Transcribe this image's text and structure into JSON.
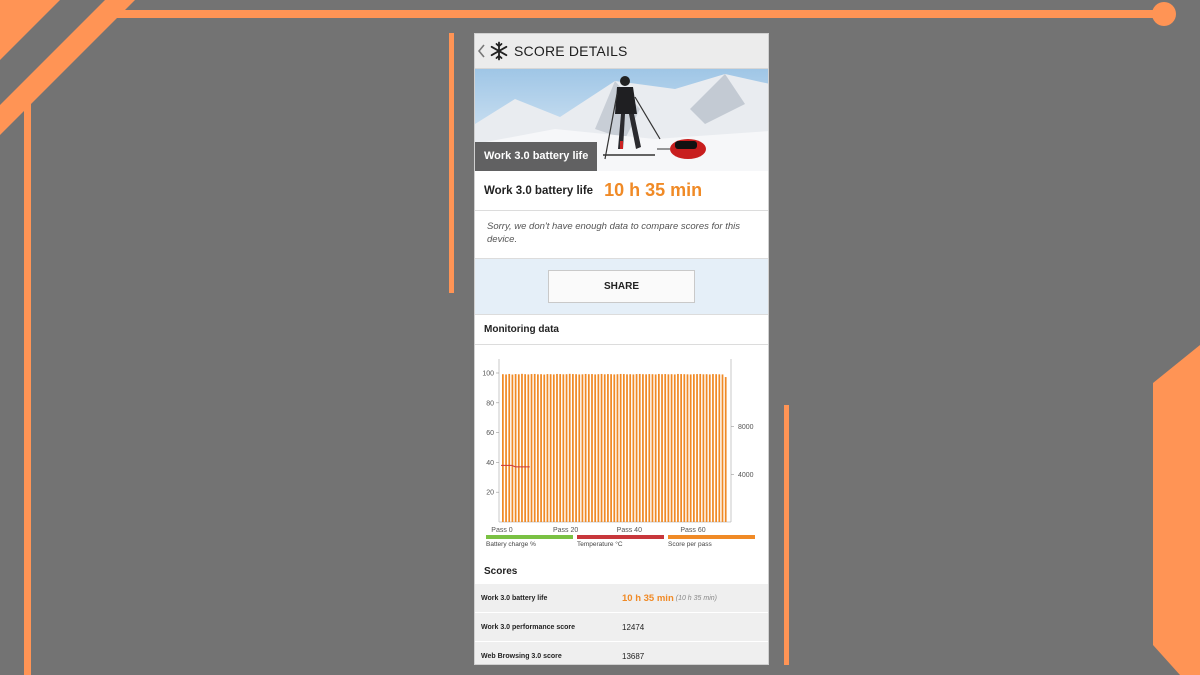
{
  "header": {
    "title": "SCORE DETAILS",
    "back_icon": "chevron-left-icon",
    "app_icon": "snowflake-icon"
  },
  "hero": {
    "caption": "Work 3.0 battery life"
  },
  "result": {
    "label": "Work 3.0 battery life",
    "value": "10 h 35 min"
  },
  "notice": "Sorry, we don't have enough data to compare scores for this device.",
  "share": {
    "label": "SHARE"
  },
  "monitoring": {
    "title": "Monitoring data"
  },
  "chart_data": {
    "type": "bar",
    "x_ticks": [
      "Pass 0",
      "Pass 20",
      "Pass 40",
      "Pass 60"
    ],
    "y_left_ticks": [
      "100",
      "80",
      "60",
      "40",
      "20"
    ],
    "y_right_ticks": [
      "8000",
      "4000"
    ],
    "ylim_left": [
      0,
      100
    ],
    "ylim_right": [
      0,
      12500
    ],
    "series": [
      {
        "name": "Battery charge %",
        "color": "#7ac143",
        "values": []
      },
      {
        "name": "Temperature °C",
        "color": "#c8373b",
        "values": [
          38,
          38,
          38,
          38,
          37,
          37,
          37,
          37,
          37
        ]
      },
      {
        "name": "Score per pass",
        "color": "#f08a26",
        "values": [
          12400,
          12380,
          12420,
          12370,
          12410,
          12390,
          12430,
          12400,
          12380,
          12410,
          12420,
          12390,
          12400,
          12370,
          12410,
          12400,
          12380,
          12420,
          12410,
          12390,
          12400,
          12430,
          12410,
          12400,
          12380,
          12390,
          12420,
          12400,
          12410,
          12380,
          12400,
          12420,
          12390,
          12410,
          12400,
          12380,
          12400,
          12420,
          12410,
          12390,
          12400,
          12380,
          12410,
          12420,
          12400,
          12390,
          12410,
          12400,
          12380,
          12420,
          12400,
          12410,
          12390,
          12400,
          12380,
          12420,
          12410,
          12400,
          12390,
          12380,
          12400,
          12410,
          12420,
          12390,
          12400,
          12380,
          12410,
          12400,
          12390,
          12380,
          12160
        ]
      }
    ]
  },
  "scores": {
    "title": "Scores",
    "rows": [
      {
        "name": "Work 3.0 battery life",
        "value": "10 h 35 min",
        "note": "(10 h 35 min)"
      },
      {
        "name": "Work 3.0 performance score",
        "value": "12474"
      },
      {
        "name": "Web Browsing 3.0 score",
        "value": "13687"
      }
    ]
  },
  "colors": {
    "accent": "#f08a26",
    "share_bg": "#e5eff8"
  }
}
